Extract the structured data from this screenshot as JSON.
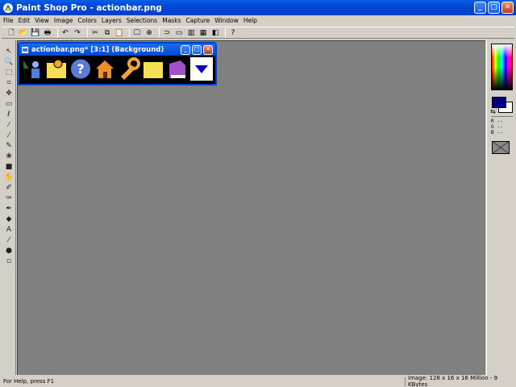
{
  "app": {
    "title": "Paint Shop Pro - actionbar.png"
  },
  "menu": [
    "File",
    "Edit",
    "View",
    "Image",
    "Colors",
    "Layers",
    "Selections",
    "Masks",
    "Capture",
    "Window",
    "Help"
  ],
  "toolbar": {
    "buttons": [
      {
        "name": "new-file",
        "glyph": "🗋"
      },
      {
        "name": "open-file",
        "glyph": "📂"
      },
      {
        "name": "save-file",
        "glyph": "💾"
      },
      {
        "name": "print",
        "glyph": "🖶"
      },
      {
        "name": "undo",
        "glyph": "↶"
      },
      {
        "name": "redo",
        "glyph": "↷"
      },
      {
        "name": "cut",
        "glyph": "✂"
      },
      {
        "name": "copy",
        "glyph": "⧉"
      },
      {
        "name": "paste",
        "glyph": "📋"
      },
      {
        "name": "full-screen-preview",
        "glyph": "🖵"
      },
      {
        "name": "normal-viewing",
        "glyph": "⊕"
      },
      {
        "name": "toggle-tool-palette",
        "glyph": "⊃"
      },
      {
        "name": "toggle-toolbar",
        "glyph": "▭"
      },
      {
        "name": "toggle-histogram",
        "glyph": "▥"
      },
      {
        "name": "toggle-overview",
        "glyph": "▦"
      },
      {
        "name": "toggle-layer-palette",
        "glyph": "◧"
      },
      {
        "name": "context-help",
        "glyph": "?"
      }
    ]
  },
  "tools": [
    {
      "name": "selector-arrow-tool",
      "glyph": "↖"
    },
    {
      "name": "zoom-tool",
      "glyph": "🔍"
    },
    {
      "name": "deform-tool",
      "glyph": "⬚"
    },
    {
      "name": "crop-tool",
      "glyph": "⌗"
    },
    {
      "name": "mover-tool",
      "glyph": "✥"
    },
    {
      "name": "selection-tool",
      "glyph": "▭"
    },
    {
      "name": "freehand-selection-tool",
      "glyph": "ℓ"
    },
    {
      "name": "magic-wand-tool",
      "glyph": "⁄"
    },
    {
      "name": "dropper-tool",
      "glyph": "⁄"
    },
    {
      "name": "paintbrush-tool",
      "glyph": "✎"
    },
    {
      "name": "clone-brush-tool",
      "glyph": "❀"
    },
    {
      "name": "color-replacer-tool",
      "glyph": "■"
    },
    {
      "name": "retouch-tool",
      "glyph": "✋"
    },
    {
      "name": "eraser-tool",
      "glyph": "✐"
    },
    {
      "name": "picture-tube-tool",
      "glyph": "✑"
    },
    {
      "name": "airbrush-tool",
      "glyph": "✒"
    },
    {
      "name": "flood-fill-tool",
      "glyph": "◆"
    },
    {
      "name": "text-tool",
      "glyph": "A"
    },
    {
      "name": "draw-tool",
      "glyph": "⁄"
    },
    {
      "name": "preset-shapes-tool",
      "glyph": "●"
    },
    {
      "name": "object-selector-tool",
      "glyph": "▫"
    }
  ],
  "colors": {
    "foreground": "#000080",
    "background": "#ffffff",
    "workspace": "#808080",
    "titlebar": "#0046d5"
  },
  "color_panel": {
    "readout": [
      "R --",
      "G --",
      "B --"
    ]
  },
  "document": {
    "title": "actionbar.png* [3:1] (Background)",
    "icons": [
      {
        "name": "user-tree-icon",
        "bg": "#2a6e1f"
      },
      {
        "name": "folder-star-icon",
        "bg": "#f6df55"
      },
      {
        "name": "help-question-icon",
        "bg": "#5b7bd6"
      },
      {
        "name": "home-icon",
        "bg": "#f08d2c"
      },
      {
        "name": "tools-wrench-icon",
        "bg": "#f2a33a"
      },
      {
        "name": "folder-icon",
        "bg": "#f6df55"
      },
      {
        "name": "book-icon",
        "bg": "#a050c8"
      },
      {
        "name": "dropdown-arrow-icon",
        "bg": "#ffffff"
      }
    ]
  },
  "status": {
    "help": "For Help, press F1",
    "image_info": "Image:  128 x 16 x 16 Million - 9 KBytes"
  }
}
